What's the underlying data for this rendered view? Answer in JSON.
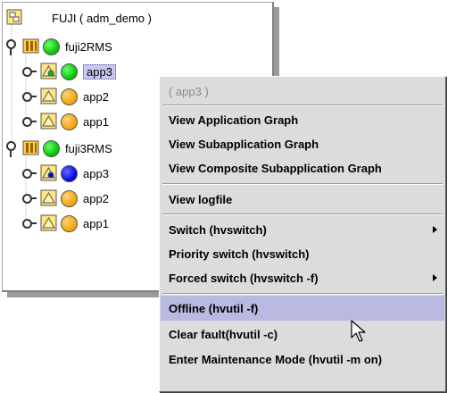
{
  "tree": {
    "root_label": "FUJI ( adm_demo )",
    "nodes": [
      {
        "label": "fuji2RMS",
        "status": "online"
      },
      {
        "label": "app3",
        "status": "online",
        "selected": true
      },
      {
        "label": "app2",
        "status": "offline"
      },
      {
        "label": "app1",
        "status": "offline"
      },
      {
        "label": "fuji3RMS",
        "status": "online"
      },
      {
        "label": "app3",
        "status": "standby"
      },
      {
        "label": "app2",
        "status": "offline"
      },
      {
        "label": "app1",
        "status": "offline"
      }
    ]
  },
  "context_menu": {
    "header": "( app3 )",
    "items": [
      {
        "label": "View Application Graph"
      },
      {
        "label": "View Subapplication Graph"
      },
      {
        "label": "View Composite Subapplication Graph"
      },
      {
        "label": "View logfile"
      },
      {
        "label": "Switch (hvswitch)",
        "submenu": true
      },
      {
        "label": "Priority switch (hvswitch)"
      },
      {
        "label": "Forced switch (hvswitch -f)",
        "submenu": true
      },
      {
        "label": "Offline (hvutil -f)",
        "highlighted": true
      },
      {
        "label": "Clear fault(hvutil -c)"
      },
      {
        "label": "Enter Maintenance Mode (hvutil -m on)"
      }
    ]
  },
  "colors": {
    "online": "#00c000",
    "offline": "#f5a000",
    "standby": "#0000e0",
    "menu_background": "#dcdcdc",
    "menu_highlight": "#b9b9e2",
    "selection": "#c8c8f0"
  },
  "icons": {
    "root": "cluster-root-icon",
    "node": "rms-node-icon",
    "app": "application-icon",
    "expand": "tree-key-icon",
    "cursor": "mouse-pointer-icon"
  }
}
